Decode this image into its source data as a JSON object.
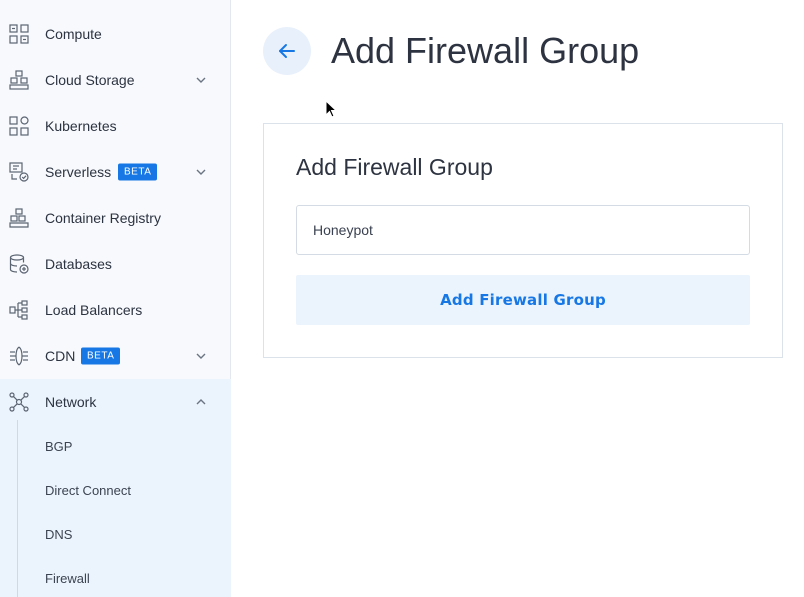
{
  "sidebar": {
    "items": [
      {
        "label": "Compute",
        "icon": "compute-icon"
      },
      {
        "label": "Cloud Storage",
        "icon": "cloud-storage-icon",
        "expandable": true
      },
      {
        "label": "Kubernetes",
        "icon": "kubernetes-icon"
      },
      {
        "label": "Serverless",
        "icon": "serverless-icon",
        "badge": "BETA",
        "expandable": true
      },
      {
        "label": "Container Registry",
        "icon": "container-registry-icon"
      },
      {
        "label": "Databases",
        "icon": "databases-icon"
      },
      {
        "label": "Load Balancers",
        "icon": "load-balancers-icon"
      },
      {
        "label": "CDN",
        "icon": "cdn-icon",
        "badge": "BETA",
        "expandable": true
      },
      {
        "label": "Network",
        "icon": "network-icon",
        "expanded": true
      }
    ],
    "network_subitems": [
      {
        "label": "BGP"
      },
      {
        "label": "Direct Connect"
      },
      {
        "label": "DNS"
      },
      {
        "label": "Firewall"
      }
    ]
  },
  "header": {
    "title": "Add Firewall Group",
    "back_icon": "arrow-left-icon"
  },
  "form": {
    "title": "Add Firewall Group",
    "description_value": "Honeypot",
    "submit_label": "Add Firewall Group"
  },
  "colors": {
    "accent": "#1778e5",
    "sidebar_bg": "#f7f9fc",
    "active_group_bg": "#ebf3fc",
    "button_bg": "#ebf3fd"
  }
}
